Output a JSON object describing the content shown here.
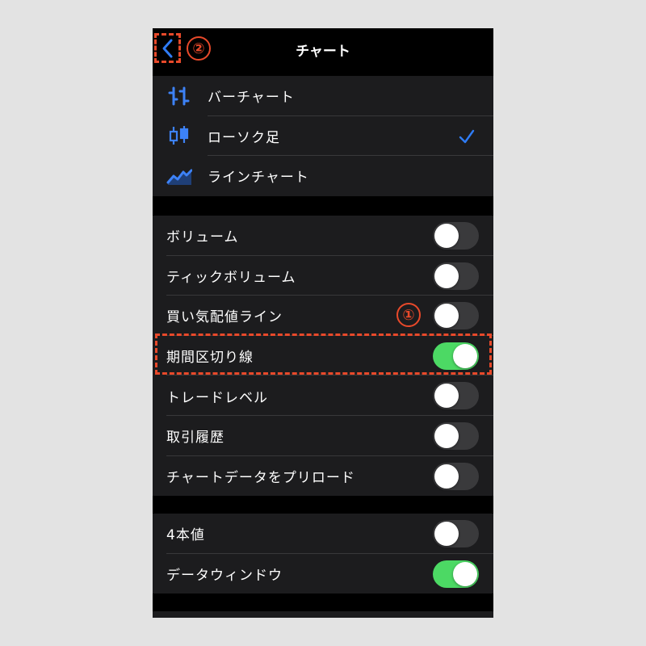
{
  "nav": {
    "title": "チャート"
  },
  "annotations": {
    "one": "①",
    "two": "②"
  },
  "chart_types": [
    {
      "label": "バーチャート",
      "icon": "bar-chart-icon",
      "selected": false
    },
    {
      "label": "ローソク足",
      "icon": "candlestick-icon",
      "selected": true
    },
    {
      "label": "ラインチャート",
      "icon": "line-chart-icon",
      "selected": false
    }
  ],
  "display_settings": [
    {
      "label": "ボリューム",
      "on": false
    },
    {
      "label": "ティックボリューム",
      "on": false
    },
    {
      "label": "買い気配値ライン",
      "on": false
    },
    {
      "label": "期間区切り線",
      "on": true
    },
    {
      "label": "トレードレベル",
      "on": false
    },
    {
      "label": "取引履歴",
      "on": false
    },
    {
      "label": "チャートデータをプリロード",
      "on": false
    }
  ],
  "extra_settings": [
    {
      "label": "4本値",
      "on": false
    },
    {
      "label": "データウィンドウ",
      "on": true
    }
  ],
  "colors": {
    "accent": "#2f7cf6",
    "toggle_on": "#4cd964",
    "annotation": "#e8492a"
  }
}
